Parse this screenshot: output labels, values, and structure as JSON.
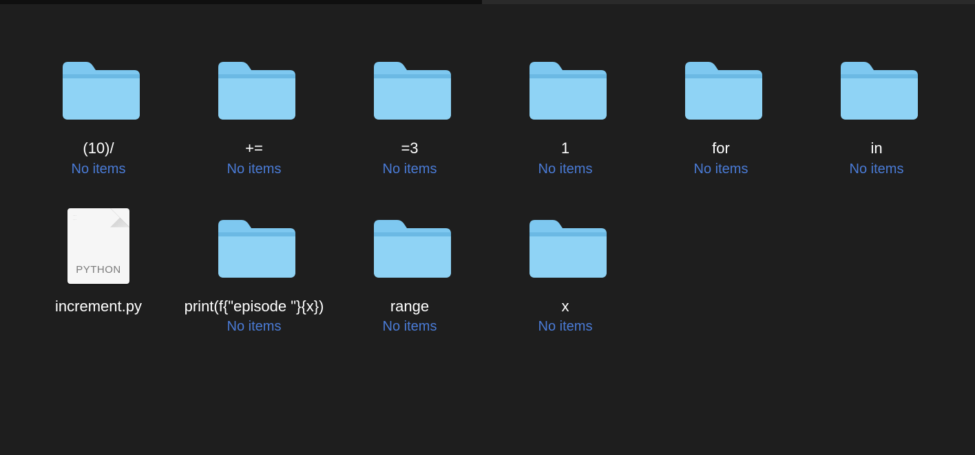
{
  "items": [
    {
      "type": "folder",
      "name": "(10)/",
      "sub": "No items"
    },
    {
      "type": "folder",
      "name": "+=",
      "sub": "No items"
    },
    {
      "type": "folder",
      "name": "=3",
      "sub": "No items"
    },
    {
      "type": "folder",
      "name": "1",
      "sub": "No items"
    },
    {
      "type": "folder",
      "name": "for",
      "sub": "No items"
    },
    {
      "type": "folder",
      "name": "in",
      "sub": "No items"
    },
    {
      "type": "file",
      "name": "increment.py",
      "kind": "PYTHON"
    },
    {
      "type": "folder",
      "name": "print(f{\"episode \"}{x})",
      "sub": "No items"
    },
    {
      "type": "folder",
      "name": "range",
      "sub": "No items"
    },
    {
      "type": "folder",
      "name": "x",
      "sub": "No items"
    }
  ]
}
